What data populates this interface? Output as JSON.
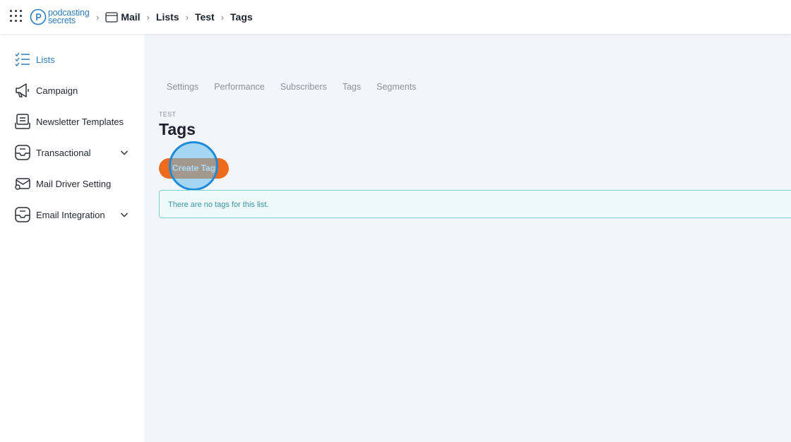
{
  "header": {
    "logo": {
      "line1": "podcasting",
      "line2": "secrets"
    },
    "breadcrumbs": [
      "Mail",
      "Lists",
      "Test",
      "Tags"
    ]
  },
  "sidebar": {
    "items": [
      {
        "label": "Lists",
        "icon": "checklist-icon",
        "active": true
      },
      {
        "label": "Campaign",
        "icon": "megaphone-icon"
      },
      {
        "label": "Newsletter Templates",
        "icon": "newsletter-icon"
      },
      {
        "label": "Transactional",
        "icon": "inbox-icon",
        "expandable": true
      },
      {
        "label": "Mail Driver Setting",
        "icon": "mail-settings-icon"
      },
      {
        "label": "Email Integration",
        "icon": "inbox-icon",
        "expandable": true
      }
    ]
  },
  "main": {
    "tabs": [
      "Settings",
      "Performance",
      "Subscribers",
      "Tags",
      "Segments"
    ],
    "eyebrow": "TEST",
    "title": "Tags",
    "create_button": "Create Tag",
    "empty_message": "There are no tags for this list."
  },
  "colors": {
    "accent_blue": "#2b7bbf",
    "button_orange": "#ef6b1c",
    "notice_border": "#7fd0d8",
    "notice_bg": "#eef9fa"
  }
}
